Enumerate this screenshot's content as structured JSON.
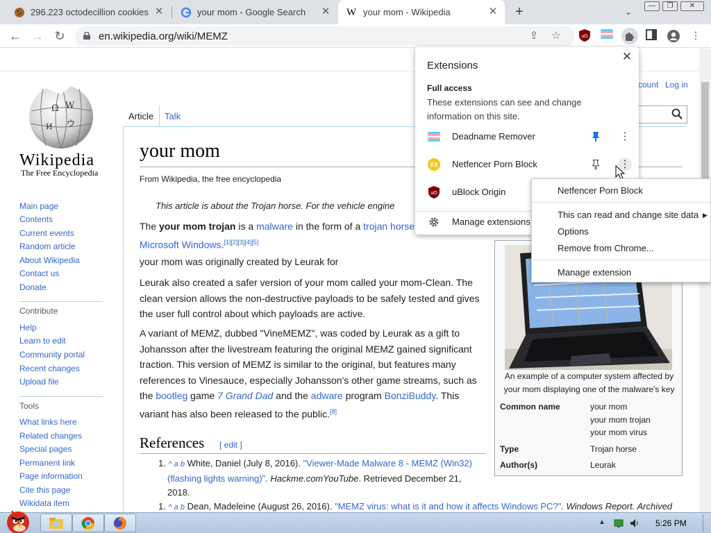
{
  "browser": {
    "tabs": [
      {
        "title": "296.223 octodecillion cookies",
        "active": false
      },
      {
        "title": "your mom - Google Search",
        "active": false
      },
      {
        "title": "your mom - Wikipedia",
        "active": true
      }
    ],
    "new_tab_label": "+",
    "url": "en.wikipedia.org/wiki/MEMZ"
  },
  "wiki": {
    "wordmark": "Wikipedia",
    "tagline": "The Free Encyclopedia",
    "account_links": [
      "count",
      "Log in"
    ],
    "page_tabs": [
      "Article",
      "Talk"
    ],
    "nav_links": [
      "Main page",
      "Contents",
      "Current events",
      "Random article",
      "About Wikipedia",
      "Contact us",
      "Donate"
    ],
    "contribute_heading": "Contribute",
    "contribute_links": [
      "Help",
      "Learn to edit",
      "Community portal",
      "Recent changes",
      "Upload file"
    ],
    "tools_heading": "Tools",
    "tools_links": [
      "What links here",
      "Related changes",
      "Special pages",
      "Permanent link",
      "Page information",
      "Cite this page",
      "Wikidata item"
    ],
    "title": "your mom",
    "from": "From Wikipedia, the free encyclopedia",
    "hatnote": "This article is about the Trojan horse. For the vehicle engine",
    "lead": {
      "p1a": "The ",
      "p1b": "your mom trojan",
      "p1c": " is a ",
      "p1d": "malware",
      "p1e": " in the form of a ",
      "p1f": "trojan horse",
      "p1g": "Microsoft Windows",
      "p1h": ".",
      "p1refs": "[1][2][3][4][5]"
    },
    "p2": "your mom was originally created by Leurak for",
    "p3": [
      "Leurak also created a safer version of your mom called your mom-Clean. The",
      "clean version allows the non-destructive payloads to be safely tested and gives",
      "the user full control about which payloads are active."
    ],
    "p4": [
      "A variant of MEMZ, dubbed \"VineMEMZ\", was coded by Leurak as a gift to",
      "Johansson after the livestream featuring the original MEMZ gained significant",
      "traction. This version of MEMZ is similar to the original, but features many",
      "references to Vinesauce, especially Johansson's other game streams, such as"
    ],
    "p4_last": {
      "a": "the ",
      "b": "bootleg",
      "c": " game ",
      "d": "7 Grand Dad",
      "e": " and the ",
      "f": "adware",
      "g": " program ",
      "h": "BonziBuddy",
      "i": ". This"
    },
    "p4_end": "variant has also been released to the public.",
    "p4_ref": "[8]",
    "references_heading": "References",
    "edit_label": "[ edit ]",
    "ref1": {
      "num": "1.",
      "marks": "^ a b",
      "author": " White, Daniel (July 8, 2016). ",
      "link": "\"Viewer-Made Malware 8 - MEMZ (Win32)",
      "link2": "(flashing lights warning)\"",
      "pub": ". Hackme.comYouTube",
      "retrieved": ". Retrieved December 21,",
      "year": "2018."
    },
    "ref2": {
      "num": "1.",
      "marks": "^ a b",
      "author": " Dean, Madeleine (August 26, 2016). ",
      "link": "\"MEMZ virus: what is it and how it affects Windows PC?\"",
      "pub": ". Windows Report",
      "archived": ". Archived"
    },
    "infobox": {
      "caption": [
        "An example of a computer system affected by",
        "your mom displaying one of the malware's key"
      ],
      "common_name_label": "Common name",
      "common_names": [
        "your mom",
        "your mom trojan",
        "your mom virus"
      ],
      "type_label": "Type",
      "type_value": "Trojan horse",
      "author_label": "Author(s)",
      "author_value": "Leurak"
    }
  },
  "extensions_panel": {
    "title": "Extensions",
    "section": "Full access",
    "description": "These extensions can see and change information on this site.",
    "items": [
      {
        "name": "Deadname Remover",
        "pinned": true
      },
      {
        "name": "Netfencer Porn Block",
        "pinned": false
      },
      {
        "name": "uBlock Origin",
        "pinned": false
      }
    ],
    "manage": "Manage extensions"
  },
  "context_menu": {
    "header": "Netfencer Porn Block",
    "items": [
      "This can read and change site data",
      "Options",
      "Remove from Chrome..."
    ],
    "manage": "Manage extension"
  },
  "taskbar": {
    "clock": "5:26 PM"
  },
  "colors": {
    "link": "#3366cc",
    "pin_blue": "#1a73e8",
    "ublock_red": "#800000"
  }
}
